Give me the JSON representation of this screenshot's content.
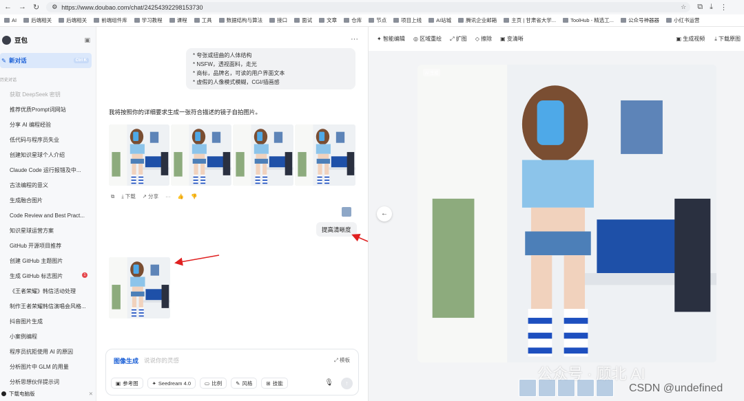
{
  "browser": {
    "url": "https://www.doubao.com/chat/24254392298153730",
    "bookmarks": [
      "AI",
      "后端相关",
      "后端相关",
      "前端组件库",
      "学习教程",
      "课程",
      "工具",
      "数据结构与算法",
      "接口",
      "面试",
      "文章",
      "仓库",
      "节点",
      "项目上线",
      "AI站城",
      "腾讯企业邮箱",
      "主页 | 甘肃省大学...",
      "ToolHub - 精选工...",
      "公众号神器器",
      "小红书运营"
    ]
  },
  "sidebar": {
    "app_name": "豆包",
    "new_chat": "新对话",
    "new_chat_kbd": "Ctrl K",
    "history_title": "历史对话",
    "items": [
      {
        "label": "获取 DeepSeek 密钥",
        "dim": true
      },
      {
        "label": "推荐优质Prompt词网站"
      },
      {
        "label": "分享 AI 编程经验"
      },
      {
        "label": "低代码与程序员失业"
      },
      {
        "label": "创建知识星球个人介绍"
      },
      {
        "label": "Claude Code 运行报错及中..."
      },
      {
        "label": "古法编程的意义"
      },
      {
        "label": "生成融合图片"
      },
      {
        "label": "Code Review and Best Pract..."
      },
      {
        "label": "知识星球运营方案"
      },
      {
        "label": "GitHub 开源项目推荐"
      },
      {
        "label": "创建 GitHub 主题图片"
      },
      {
        "label": "生成 GitHub 标志图片",
        "badge": "1"
      },
      {
        "label": "《王者荣耀》韩信活动处理"
      },
      {
        "label": "制作王者荣耀韩信演唱会风格..."
      },
      {
        "label": "抖音图片生成"
      },
      {
        "label": "小案例编程"
      },
      {
        "label": "程序员抗拒使用 AI 的原因"
      },
      {
        "label": "分析图片中 GLM 的用量"
      },
      {
        "label": "分析思想伙伴提示词"
      }
    ],
    "bottom": "下载电脑版"
  },
  "chat": {
    "user_lines": [
      "* 夸张或扭曲的人体结构",
      "* NSFW，透视面料，走光",
      "* 商标，品牌名，可读的用户界面文本",
      "* 虚假的人像模式模糊，CGI/插画感"
    ],
    "reply": "我将按照你的详细要求生成一张符合描述的镜子自拍图片。",
    "actions": [
      "下载",
      "分享"
    ],
    "enhance": "提高清晰度",
    "input": {
      "mode": "图像生成",
      "placeholder": "说说你的灵感",
      "template": "模板",
      "tools": [
        "参考图",
        "Seedream 4.0",
        "比例",
        "风格",
        "技能"
      ]
    }
  },
  "viewer": {
    "tools": [
      "智能编辑",
      "区域重绘",
      "扩图",
      "擦除",
      "变清晰"
    ],
    "right_tools": [
      "生成视频",
      "下载原图"
    ],
    "ai_tag": "AI 生成"
  },
  "watermark": {
    "line1": "公众号 · 顾北 AI",
    "line2": "CSDN @undefined"
  }
}
